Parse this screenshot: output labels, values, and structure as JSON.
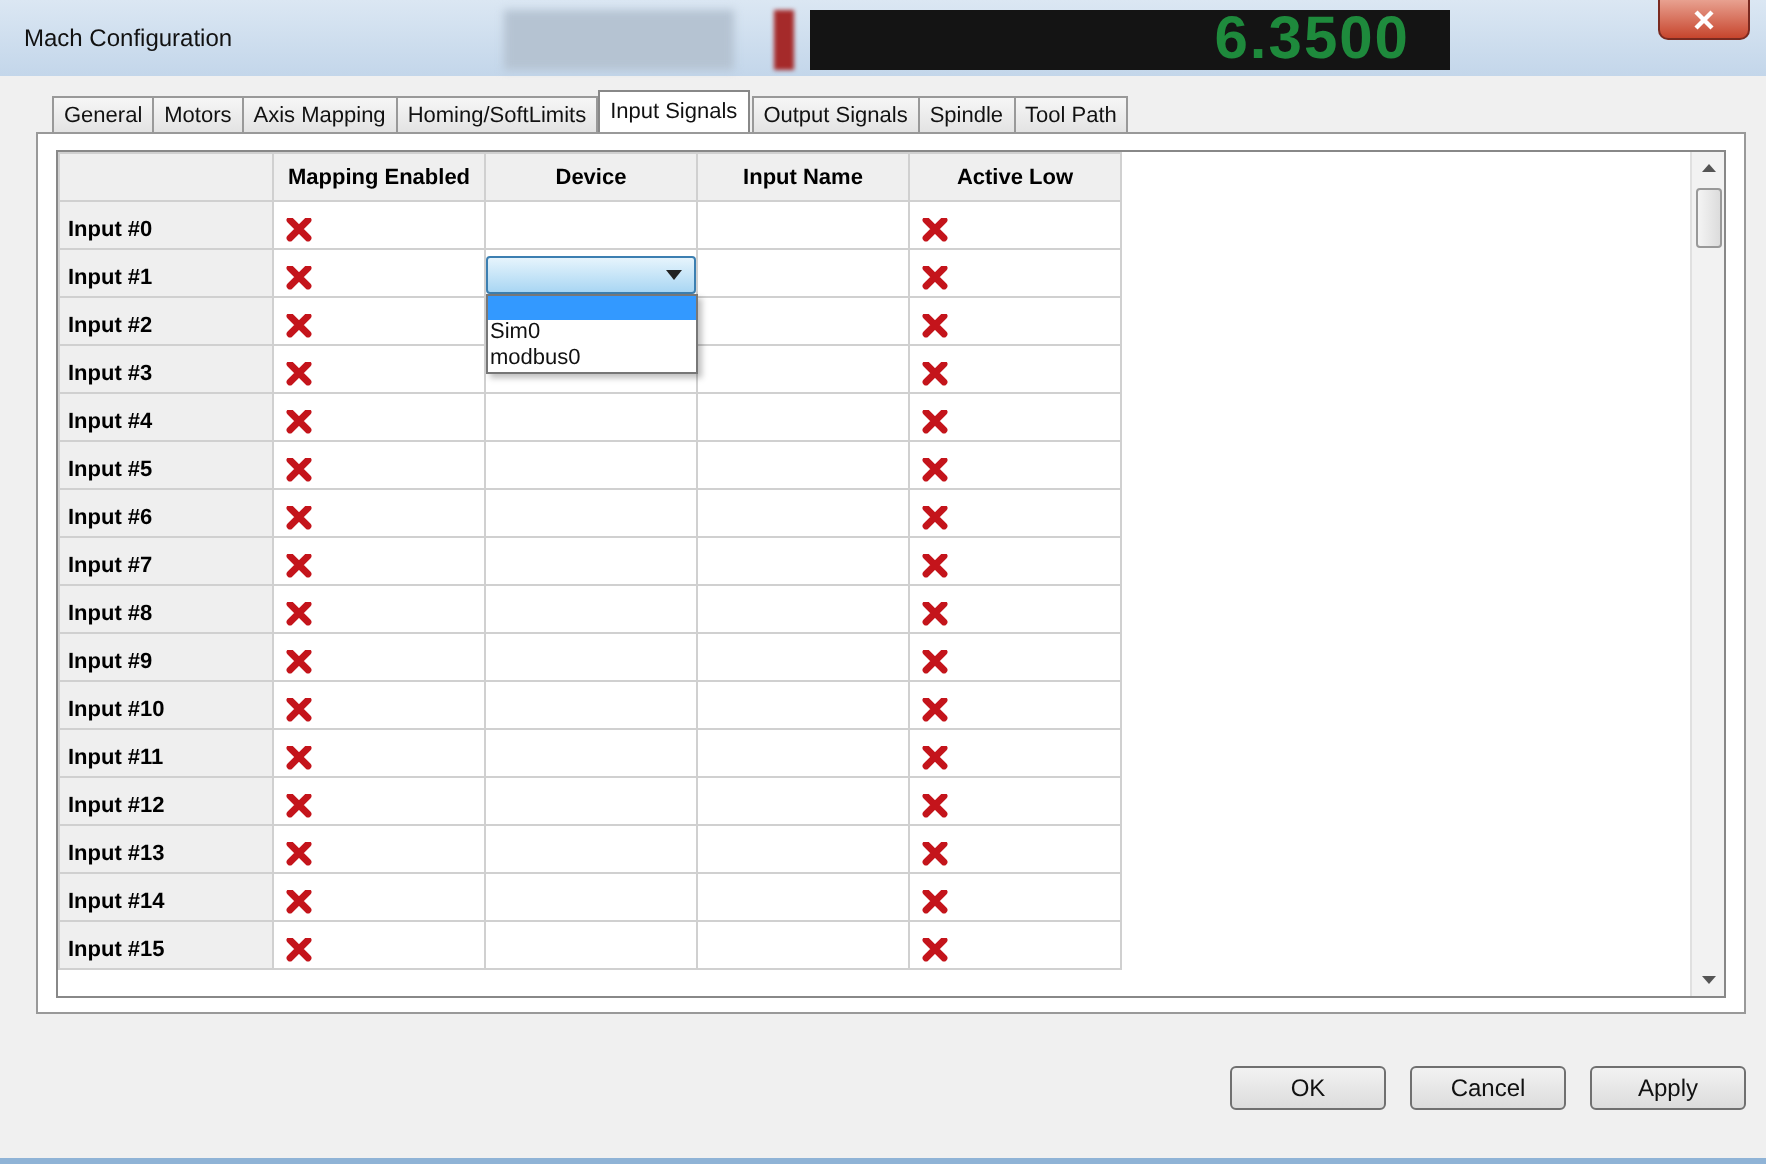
{
  "window": {
    "title": "Mach Configuration",
    "background_display": "6.3500"
  },
  "tabs": [
    {
      "label": "General",
      "selected": false
    },
    {
      "label": "Motors",
      "selected": false
    },
    {
      "label": "Axis Mapping",
      "selected": false
    },
    {
      "label": "Homing/SoftLimits",
      "selected": false
    },
    {
      "label": "Input Signals",
      "selected": true
    },
    {
      "label": "Output Signals",
      "selected": false
    },
    {
      "label": "Spindle",
      "selected": false
    },
    {
      "label": "Tool Path",
      "selected": false
    }
  ],
  "table": {
    "columns": [
      "Mapping Enabled",
      "Device",
      "Input Name",
      "Active Low"
    ],
    "rows": [
      {
        "name": "Input #0",
        "mapping_enabled": false,
        "active_low": false
      },
      {
        "name": "Input #1",
        "mapping_enabled": false,
        "active_low": false,
        "device_dropdown": {
          "open": true,
          "options": [
            "Sim0",
            "modbus0"
          ]
        }
      },
      {
        "name": "Input #2",
        "mapping_enabled": false,
        "active_low": false
      },
      {
        "name": "Input #3",
        "mapping_enabled": false,
        "active_low": false
      },
      {
        "name": "Input #4",
        "mapping_enabled": false,
        "active_low": false
      },
      {
        "name": "Input #5",
        "mapping_enabled": false,
        "active_low": false
      },
      {
        "name": "Input #6",
        "mapping_enabled": false,
        "active_low": false
      },
      {
        "name": "Input #7",
        "mapping_enabled": false,
        "active_low": false
      },
      {
        "name": "Input #8",
        "mapping_enabled": false,
        "active_low": false
      },
      {
        "name": "Input #9",
        "mapping_enabled": false,
        "active_low": false
      },
      {
        "name": "Input #10",
        "mapping_enabled": false,
        "active_low": false
      },
      {
        "name": "Input #11",
        "mapping_enabled": false,
        "active_low": false
      },
      {
        "name": "Input #12",
        "mapping_enabled": false,
        "active_low": false
      },
      {
        "name": "Input #13",
        "mapping_enabled": false,
        "active_low": false
      },
      {
        "name": "Input #14",
        "mapping_enabled": false,
        "active_low": false
      },
      {
        "name": "Input #15",
        "mapping_enabled": false,
        "active_low": false
      }
    ]
  },
  "buttons": [
    "OK",
    "Cancel",
    "Apply"
  ]
}
